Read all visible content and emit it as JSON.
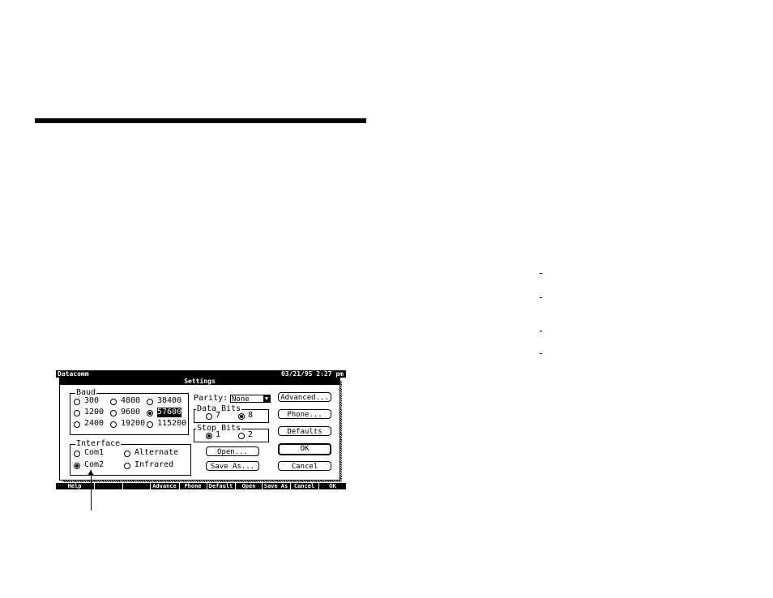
{
  "window": {
    "app_title": "Datacomm",
    "datetime": "03/21/95  2:27 pm"
  },
  "dialog": {
    "title": "Settings",
    "baud": {
      "label": "Baud",
      "options": [
        {
          "label": "300",
          "selected": false
        },
        {
          "label": "4800",
          "selected": false
        },
        {
          "label": "38400",
          "selected": false
        },
        {
          "label": "1200",
          "selected": false
        },
        {
          "label": "9600",
          "selected": false
        },
        {
          "label": "57600",
          "selected": true
        },
        {
          "label": "2400",
          "selected": false
        },
        {
          "label": "19200",
          "selected": false
        },
        {
          "label": "115200",
          "selected": false
        }
      ]
    },
    "interface": {
      "label": "Interface",
      "options": [
        {
          "label": "Com1",
          "selected": false
        },
        {
          "label": "Alternate",
          "selected": false
        },
        {
          "label": "Com2",
          "selected": true
        },
        {
          "label": "Infrared",
          "selected": false
        }
      ]
    },
    "parity": {
      "label": "Parity:",
      "value": "None"
    },
    "data_bits": {
      "label": "Data Bits",
      "options": [
        {
          "label": "7",
          "selected": false
        },
        {
          "label": "8",
          "selected": true
        }
      ]
    },
    "stop_bits": {
      "label": "Stop Bits",
      "options": [
        {
          "label": "1",
          "selected": true
        },
        {
          "label": "2",
          "selected": false
        }
      ]
    },
    "buttons": {
      "open": "Open...",
      "save_as": "Save As...",
      "advanced": "Advanced...",
      "phone": "Phone...",
      "defaults": "Defaults",
      "ok": "OK",
      "cancel": "Cancel"
    }
  },
  "function_keys": [
    "Help",
    "",
    "",
    "Advance",
    "Phone",
    "Default",
    "Open",
    "Save As",
    "Cancel",
    "OK"
  ]
}
